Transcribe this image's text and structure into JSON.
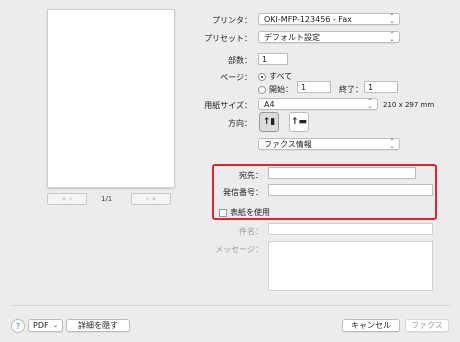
{
  "preview": {
    "prev_first": "«",
    "prev": "‹",
    "page_indicator": "1/1",
    "next": "›",
    "next_last": "»"
  },
  "printer": {
    "label": "プリンタ：",
    "value": "OKI-MFP-123456 - Fax"
  },
  "preset": {
    "label": "プリセット：",
    "value": "デフォルト設定"
  },
  "copies": {
    "label": "部数：",
    "value": "1"
  },
  "pages": {
    "label": "ページ：",
    "all_label": "すべて",
    "from_label": "開始：",
    "from_value": "1",
    "to_label": "終了：",
    "to_value": "1"
  },
  "paper_size": {
    "label": "用紙サイズ：",
    "value": "A4",
    "dimensions": "210 x 297 mm"
  },
  "orientation": {
    "label": "方向："
  },
  "section_select": {
    "value": "ファクス情報"
  },
  "fax": {
    "destination_label": "宛先：",
    "destination_value": "",
    "sender_number_label": "発信番号：",
    "sender_number_value": "",
    "cover_label": "表紙を使用",
    "subject_label": "件名：",
    "subject_value": "",
    "message_label": "メッセージ：",
    "message_value": ""
  },
  "footer": {
    "help": "?",
    "pdf_label": "PDF",
    "hide_details_label": "詳細を隠す",
    "cancel_label": "キャンセル",
    "fax_label": "ファクス"
  },
  "colors": {
    "highlight_border": "#e0232e"
  }
}
